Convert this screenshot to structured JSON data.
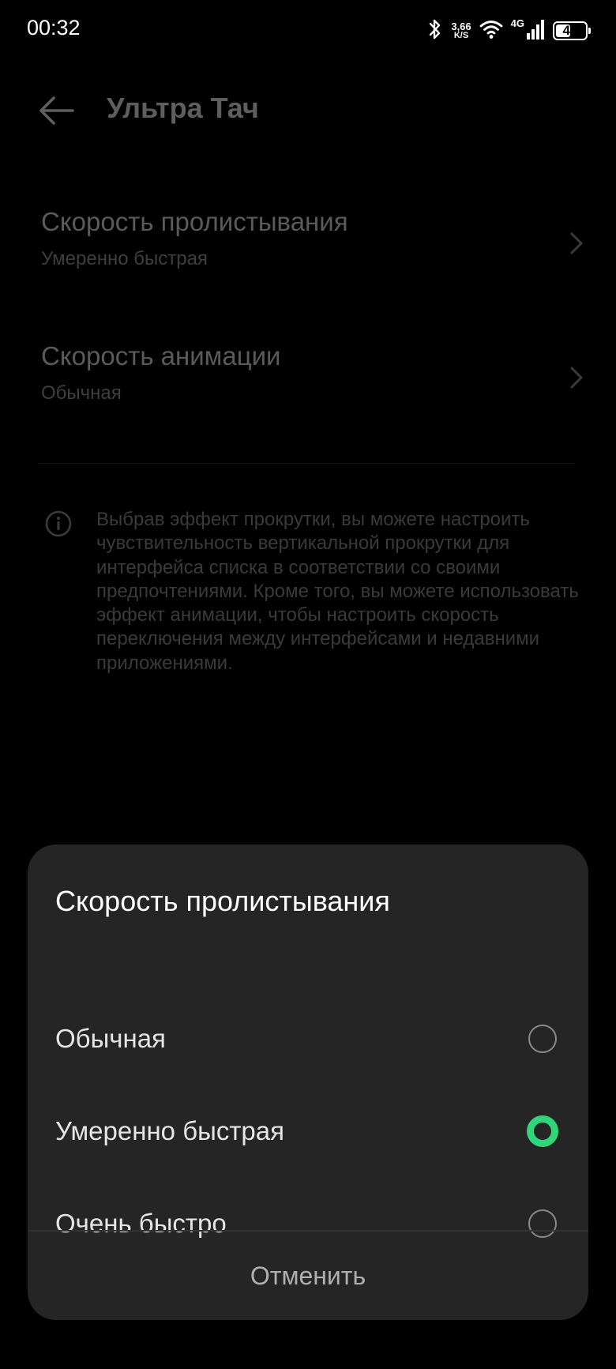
{
  "status_bar": {
    "time": "00:32",
    "net_speed_value": "3,66",
    "net_speed_unit": "K/S",
    "network_type": "4G",
    "battery_level": "42"
  },
  "header": {
    "title": "Ультра Тач"
  },
  "settings": [
    {
      "title": "Скорость пролистывания",
      "value": "Умеренно быстрая"
    },
    {
      "title": "Скорость анимации",
      "value": "Обычная"
    }
  ],
  "info": {
    "text": "Выбрав эффект прокрутки, вы можете настроить чувствительность вертикальной прокрутки для интерфейса списка в соответствии со своими предпочтениями. Кроме того, вы можете использовать эффект анимации, чтобы настроить скорость переключения между интерфейсами и недавними приложениями."
  },
  "dialog": {
    "title": "Скорость пролистывания",
    "options": [
      {
        "label": "Обычная",
        "selected": false
      },
      {
        "label": "Умеренно быстрая",
        "selected": true
      },
      {
        "label": "Очень быстро",
        "selected": false
      }
    ],
    "cancel_label": "Отменить"
  },
  "colors": {
    "accent": "#2fd67a",
    "sheet_background": "#252525",
    "background": "#000000"
  }
}
